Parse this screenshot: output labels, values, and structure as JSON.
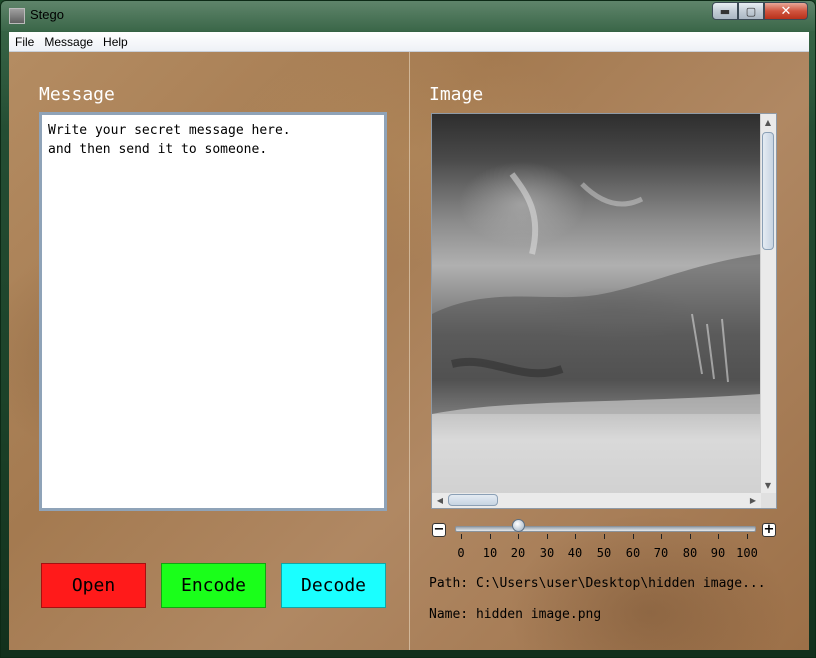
{
  "window": {
    "title": "Stego",
    "caption": {
      "minimize": "▬",
      "maximize": "▢",
      "close": "✕"
    }
  },
  "menu": [
    "File",
    "Message",
    "Help"
  ],
  "left": {
    "heading": "Message",
    "message_text": "Write your secret message here.\nand then send it to someone.",
    "buttons": [
      {
        "label": "Open",
        "color": "#ff1a1a"
      },
      {
        "label": "Encode",
        "color": "#1aff1a"
      },
      {
        "label": "Decode",
        "color": "#1affff"
      }
    ]
  },
  "right": {
    "heading": "Image",
    "zoom": {
      "minus": "−",
      "plus": "+",
      "value": 20,
      "min": 0,
      "max": 100,
      "tick_labels": [
        "0",
        "10",
        "20",
        "30",
        "40",
        "50",
        "60",
        "70",
        "80",
        "90",
        "100"
      ]
    },
    "path_line": "Path: C:\\Users\\user\\Desktop\\hidden image...",
    "name_line": "Name: hidden image.png"
  },
  "colors": {
    "open": "#ff1a1a",
    "encode": "#1aff1a",
    "decode": "#1affff"
  }
}
